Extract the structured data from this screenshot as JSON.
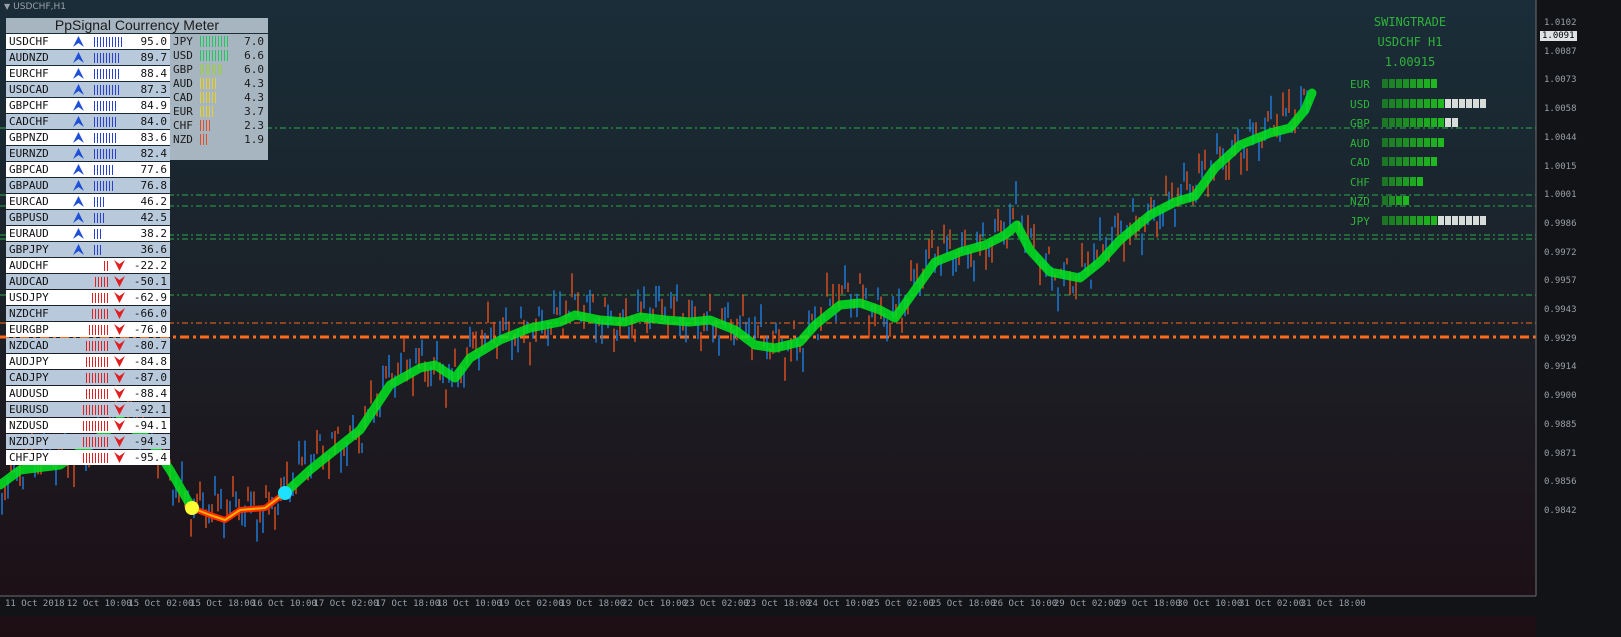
{
  "window": {
    "title": "USDCHF,H1"
  },
  "meter": {
    "title": "PpSignal Courrency Meter",
    "pairs": [
      {
        "name": "USDCHF",
        "value": "95.0",
        "dir": "up",
        "bars": 10
      },
      {
        "name": "AUDNZD",
        "value": "89.7",
        "dir": "up",
        "bars": 9
      },
      {
        "name": "EURCHF",
        "value": "88.4",
        "dir": "up",
        "bars": 9
      },
      {
        "name": "USDCAD",
        "value": "87.3",
        "dir": "up",
        "bars": 9
      },
      {
        "name": "GBPCHF",
        "value": "84.9",
        "dir": "up",
        "bars": 8
      },
      {
        "name": "CADCHF",
        "value": "84.0",
        "dir": "up",
        "bars": 8
      },
      {
        "name": "GBPNZD",
        "value": "83.6",
        "dir": "up",
        "bars": 8
      },
      {
        "name": "EURNZD",
        "value": "82.4",
        "dir": "up",
        "bars": 8
      },
      {
        "name": "GBPCAD",
        "value": "77.6",
        "dir": "up",
        "bars": 7
      },
      {
        "name": "GBPAUD",
        "value": "76.8",
        "dir": "up",
        "bars": 7
      },
      {
        "name": "EURCAD",
        "value": "46.2",
        "dir": "up",
        "bars": 4
      },
      {
        "name": "GBPUSD",
        "value": "42.5",
        "dir": "up",
        "bars": 4
      },
      {
        "name": "EURAUD",
        "value": "38.2",
        "dir": "up",
        "bars": 3
      },
      {
        "name": "GBPJPY",
        "value": "36.6",
        "dir": "up",
        "bars": 3
      },
      {
        "name": "AUDCHF",
        "value": "-22.2",
        "dir": "down",
        "bars": 2
      },
      {
        "name": "AUDCAD",
        "value": "-50.1",
        "dir": "down",
        "bars": 5
      },
      {
        "name": "USDJPY",
        "value": "-62.9",
        "dir": "down",
        "bars": 6
      },
      {
        "name": "NZDCHF",
        "value": "-66.0",
        "dir": "down",
        "bars": 6
      },
      {
        "name": "EURGBP",
        "value": "-76.0",
        "dir": "down",
        "bars": 7
      },
      {
        "name": "NZDCAD",
        "value": "-80.7",
        "dir": "down",
        "bars": 8
      },
      {
        "name": "AUDJPY",
        "value": "-84.8",
        "dir": "down",
        "bars": 8
      },
      {
        "name": "CADJPY",
        "value": "-87.0",
        "dir": "down",
        "bars": 8
      },
      {
        "name": "AUDUSD",
        "value": "-88.4",
        "dir": "down",
        "bars": 8
      },
      {
        "name": "EURUSD",
        "value": "-92.1",
        "dir": "down",
        "bars": 9
      },
      {
        "name": "NZDUSD",
        "value": "-94.1",
        "dir": "down",
        "bars": 9
      },
      {
        "name": "NZDJPY",
        "value": "-94.3",
        "dir": "down",
        "bars": 9
      },
      {
        "name": "CHFJPY",
        "value": "-95.4",
        "dir": "down",
        "bars": 9
      }
    ],
    "strength": [
      {
        "currency": "JPY",
        "value": "7.0",
        "bars": 10,
        "color": "#22c55e"
      },
      {
        "currency": "USD",
        "value": "6.6",
        "bars": 10,
        "color": "#22c55e"
      },
      {
        "currency": "GBP",
        "value": "6.0",
        "bars": 8,
        "color": "#9ccf3a"
      },
      {
        "currency": "AUD",
        "value": "4.3",
        "bars": 6,
        "color": "#e8d22a"
      },
      {
        "currency": "CAD",
        "value": "4.3",
        "bars": 6,
        "color": "#e8d22a"
      },
      {
        "currency": "EUR",
        "value": "3.7",
        "bars": 5,
        "color": "#e8d22a"
      },
      {
        "currency": "CHF",
        "value": "2.3",
        "bars": 4,
        "color": "#e0502a"
      },
      {
        "currency": "NZD",
        "value": "1.9",
        "bars": 3,
        "color": "#e0502a"
      }
    ]
  },
  "swingtrade": {
    "title": "SWINGTRADE",
    "symbol": "USDCHF H1",
    "price": "1.00915",
    "rows": [
      {
        "currency": "EUR",
        "green": 8,
        "white": 0
      },
      {
        "currency": "USD",
        "green": 9,
        "white": 6
      },
      {
        "currency": "GBP",
        "green": 9,
        "white": 2
      },
      {
        "currency": "AUD",
        "green": 9,
        "white": 0
      },
      {
        "currency": "CAD",
        "green": 8,
        "white": 0
      },
      {
        "currency": "CHF",
        "green": 6,
        "white": 0
      },
      {
        "currency": "NZD",
        "green": 4,
        "white": 0
      },
      {
        "currency": "JPY",
        "green": 8,
        "white": 7
      }
    ]
  },
  "axis": {
    "price_labels": [
      "1.0102",
      "1.0087",
      "1.0073",
      "1.0058",
      "1.0044",
      "1.0015",
      "1.0001",
      "0.9986",
      "0.9972",
      "0.9957",
      "0.9943",
      "0.9929",
      "0.9914",
      "0.9900",
      "0.9885",
      "0.9871",
      "0.9856",
      "0.9842"
    ],
    "current_price": "1.0091",
    "time_labels": [
      "11 Oct 2018",
      "12 Oct 10:00",
      "15 Oct 02:00",
      "15 Oct 18:00",
      "16 Oct 10:00",
      "17 Oct 02:00",
      "17 Oct 18:00",
      "18 Oct 10:00",
      "19 Oct 02:00",
      "19 Oct 18:00",
      "22 Oct 10:00",
      "23 Oct 02:00",
      "23 Oct 18:00",
      "24 Oct 10:00",
      "25 Oct 02:00",
      "25 Oct 18:00",
      "26 Oct 10:00",
      "29 Oct 02:00",
      "29 Oct 18:00",
      "30 Oct 10:00",
      "31 Oct 02:00",
      "31 Oct 18:00"
    ]
  },
  "colors": {
    "up_arrow": "#1f4fd6",
    "down_arrow": "#e02020",
    "up_bars": "#2a40d0",
    "down_bars": "#e02020",
    "ma_up": "#00e620",
    "ma_down": "#ff2a00",
    "candle_bull": "#1e7fe0",
    "candle_bear": "#e0501e",
    "level_green": "#2ea84a",
    "level_orange": "#ff6a1a",
    "swing_block_green": "#1fb81f",
    "swing_block_white": "#d8dcd8"
  }
}
